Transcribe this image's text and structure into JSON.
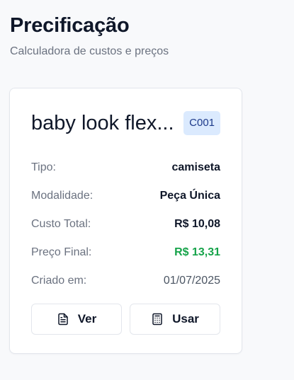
{
  "header": {
    "title": "Precificação",
    "subtitle": "Calculadora de custos e preços"
  },
  "card": {
    "name": "baby look flex...",
    "code": "C001",
    "rows": {
      "tipo": {
        "label": "Tipo:",
        "value": "camiseta"
      },
      "modalidade": {
        "label": "Modalidade:",
        "value": "Peça Única"
      },
      "custo_total": {
        "label": "Custo Total:",
        "value": "R$ 10,08"
      },
      "preco_final": {
        "label": "Preço Final:",
        "value": "R$ 13,31"
      },
      "criado_em": {
        "label": "Criado em:",
        "value": "01/07/2025"
      }
    },
    "actions": {
      "ver": {
        "label": "Ver",
        "icon": "file-text-icon"
      },
      "usar": {
        "label": "Usar",
        "icon": "calculator-icon"
      }
    }
  },
  "colors": {
    "price_green": "#16a34a",
    "badge_bg": "#dbeafe",
    "badge_text": "#1e3a8a"
  }
}
